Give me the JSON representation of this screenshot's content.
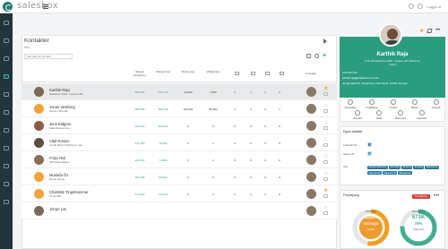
{
  "app": {
    "brand": "salesbox",
    "login_label": "Logga ut"
  },
  "sidebar": {
    "items": [
      "home-icon",
      "menu-icon",
      "contacts-icon",
      "accounts-icon",
      "calendar-icon",
      "tasks-icon",
      "pipeline-icon",
      "insights-icon",
      "settings-icon",
      "help-icon",
      "chat-icon"
    ],
    "active_index": 3
  },
  "contacts": {
    "title": "Kontakter",
    "subtitle": "Alla",
    "search_placeholder": "Sök efter en kontakt",
    "columns": [
      "Stängd försäljning",
      "Stängt vinst",
      "Brutto pipe",
      "Viktad pipe",
      "",
      "",
      "",
      "",
      "Ansvarig"
    ],
    "rows": [
      {
        "name": "Karthik Raja",
        "company": "Salesbox CRM - System AB",
        "values": [
          "552,524",
          "515,710",
          "13,000",
          "1,500",
          "4",
          "1",
          "1",
          "2"
        ],
        "star": true,
        "selected": true,
        "avatar": "#7e6656"
      },
      {
        "name": "Jonas Vestberg",
        "company": "Senior HSS AB",
        "values": [
          "580,136",
          "580,136",
          "115,920",
          "86,942",
          "1",
          "-1",
          "0",
          "1"
        ],
        "star": false,
        "selected": false,
        "avatar": "#f2a33a"
      },
      {
        "name": "Jens Eldgren",
        "company": "Säkerhetsservice",
        "values": [
          "296,654",
          "299,523",
          "0",
          "0",
          "0",
          "0",
          "0",
          "0"
        ],
        "star": false,
        "selected": false,
        "avatar": "#8b5b42"
      },
      {
        "name": "Vlad Rostov",
        "company": "Credit Bank Of Moscow Jsc",
        "values": [
          "271,200",
          "78,000",
          "0",
          "1",
          "0",
          "0",
          "0",
          "0"
        ],
        "star": false,
        "selected": false,
        "avatar": "#5a5046"
      },
      {
        "name": "Frida Test",
        "company": "AB Frida Hilstad",
        "values": [
          "222,906",
          "74,804",
          "0",
          "4",
          "0",
          "0",
          "0",
          "0"
        ],
        "star": false,
        "selected": false,
        "avatar": "#8a6d58"
      },
      {
        "name": "Mustafa Öz",
        "company": "Exotic Group",
        "values": [
          "191,348",
          "88,532",
          "0",
          "0",
          "0",
          "0",
          "0",
          "0"
        ],
        "star": false,
        "selected": false,
        "avatar": "#f2a33a"
      },
      {
        "name": "Charlotte Tingshammar",
        "company": "Omfiz AB",
        "values": [
          "174,923",
          "174,923",
          "0",
          "0",
          "0",
          "0",
          "0",
          "0"
        ],
        "star": true,
        "selected": false,
        "avatar": "#f2a33a"
      },
      {
        "name": "Johan Lim",
        "company": "",
        "values": [
          "",
          "",
          "",
          "",
          "",
          "",
          "",
          ""
        ],
        "star": false,
        "selected": false,
        "avatar": "#7a6a5a"
      }
    ]
  },
  "profile": {
    "name": "Karthik Raja",
    "title": "CTO på Salesbox CRM - System AB Influencer",
    "client": "Client",
    "phone": "0737167152",
    "email": "karthik.raja@salesboxcrm.com",
    "address": "Jungfrugatan 6, Stockholm, New Delhi, 11446, Sverige",
    "actions": [
      "Utvecklare",
      "Kvalificera",
      "Orders",
      "Möten",
      "Historik",
      "Anteckn",
      "Tasks",
      "Dokument",
      "Kalender"
    ]
  },
  "details": {
    "title": "Egna datafält",
    "linkedin_label": "LinkedIn ID",
    "linkedin_value": "in",
    "skype_label": "Skype ID",
    "skype_value": "S",
    "tag_label": "Tag",
    "tags": [
      "#PaidProfitCheck",
      "#TestTag",
      "#Phone",
      "#Follow",
      "#tagname1",
      "#tagname2",
      "#tagname3",
      "#tagname4"
    ]
  },
  "sales": {
    "title": "Försäljning",
    "badge": "Försäljning",
    "left_gauge": {
      "label_top": "Snittaffär",
      "value": "336K",
      "sub": "88Dagar",
      "bottom": "Snittid"
    },
    "right_gauge": {
      "label_top": "Försäljning",
      "value": "673K",
      "percent": "76%",
      "bottom": "Marginal"
    }
  }
}
